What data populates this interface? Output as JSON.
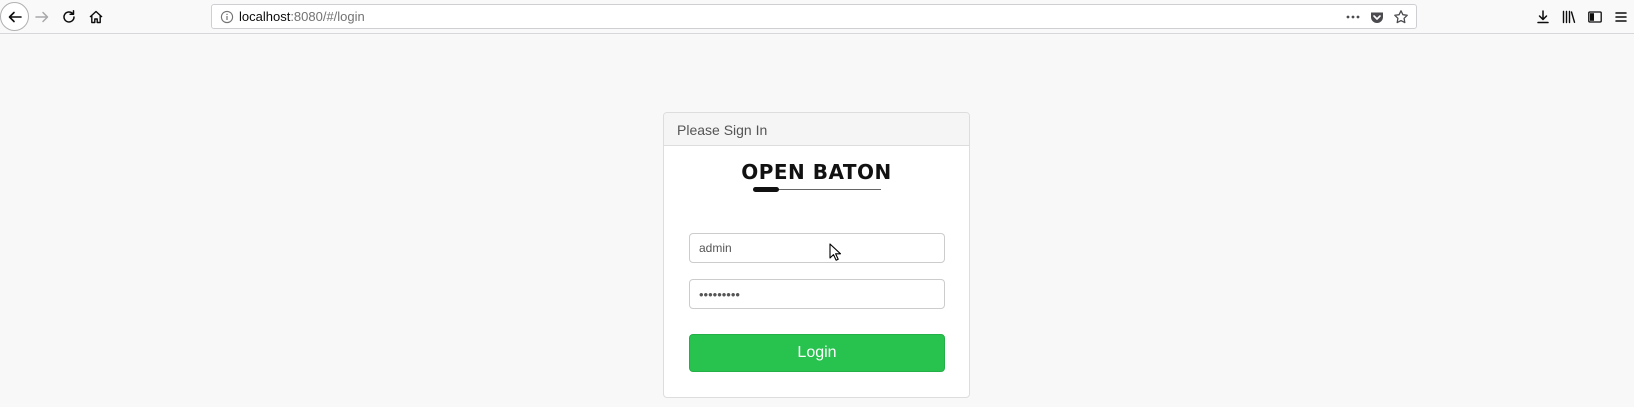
{
  "browser": {
    "url_host": "localhost",
    "url_rest": ":8080/#/login",
    "icons": {
      "back": "back-arrow-icon",
      "forward": "forward-arrow-icon",
      "reload": "reload-icon",
      "home": "home-icon",
      "info": "info-icon",
      "more": "more-actions-icon",
      "pocket": "pocket-icon",
      "bookmark": "bookmark-star-icon",
      "downloads": "download-icon",
      "library": "library-icon",
      "sidebar": "sidebar-icon",
      "menu": "hamburger-menu-icon"
    }
  },
  "login": {
    "heading": "Please Sign In",
    "logo_text": "OPEN BATON",
    "username_value": "admin",
    "password_value": "•••••••••",
    "login_label": "Login",
    "accent_color": "#28c24f"
  }
}
